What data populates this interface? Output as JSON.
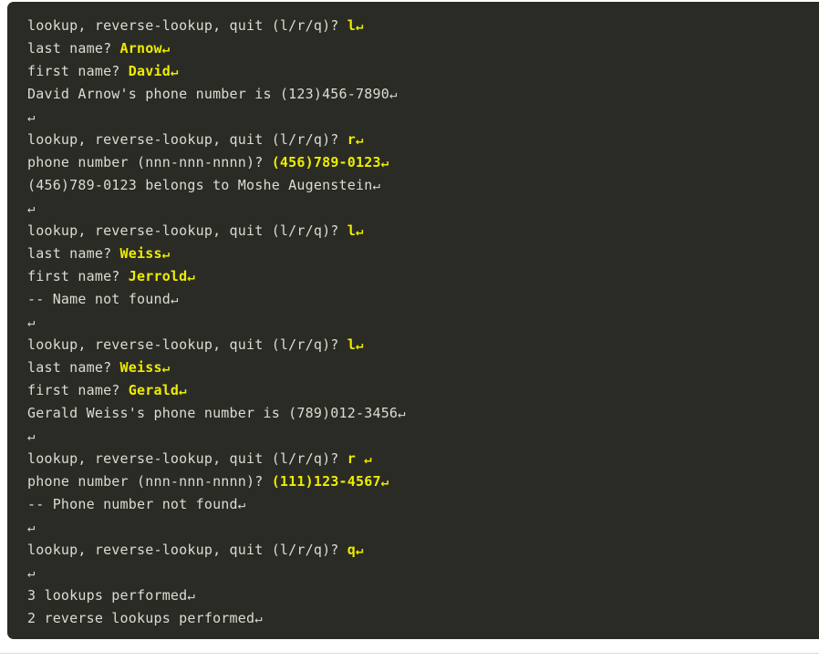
{
  "page": {
    "background_color": "#ffffff",
    "bottom_rule_color": "#d8d8d8"
  },
  "console": {
    "background_color": "#2b2b26",
    "output_text_color": "#dcdcd4",
    "input_text_color": "#eded00",
    "return_glyph": "↵",
    "lines": [
      {
        "index": 0,
        "segments": [
          {
            "kind": "output",
            "text": "lookup, reverse-lookup, quit (l/r/q)? "
          },
          {
            "kind": "input",
            "text": "l"
          },
          {
            "kind": "return-input",
            "text": "↵"
          }
        ]
      },
      {
        "index": 1,
        "segments": [
          {
            "kind": "output",
            "text": "last name? "
          },
          {
            "kind": "input",
            "text": "Arnow"
          },
          {
            "kind": "return-input",
            "text": "↵"
          }
        ]
      },
      {
        "index": 2,
        "segments": [
          {
            "kind": "output",
            "text": "first name? "
          },
          {
            "kind": "input",
            "text": "David"
          },
          {
            "kind": "return-input",
            "text": "↵"
          }
        ]
      },
      {
        "index": 3,
        "segments": [
          {
            "kind": "output",
            "text": "David Arnow's phone number is (123)456-7890"
          },
          {
            "kind": "return-output",
            "text": "↵"
          }
        ]
      },
      {
        "index": 4,
        "segments": [
          {
            "kind": "return-output",
            "text": "↵"
          }
        ]
      },
      {
        "index": 5,
        "segments": [
          {
            "kind": "output",
            "text": "lookup, reverse-lookup, quit (l/r/q)? "
          },
          {
            "kind": "input",
            "text": "r"
          },
          {
            "kind": "return-input",
            "text": "↵"
          }
        ]
      },
      {
        "index": 6,
        "segments": [
          {
            "kind": "output",
            "text": "phone number (nnn-nnn-nnnn)? "
          },
          {
            "kind": "input",
            "text": "(456)789-0123"
          },
          {
            "kind": "return-input",
            "text": "↵"
          }
        ]
      },
      {
        "index": 7,
        "segments": [
          {
            "kind": "output",
            "text": "(456)789-0123 belongs to Moshe Augenstein"
          },
          {
            "kind": "return-output",
            "text": "↵"
          }
        ]
      },
      {
        "index": 8,
        "segments": [
          {
            "kind": "return-output",
            "text": "↵"
          }
        ]
      },
      {
        "index": 9,
        "segments": [
          {
            "kind": "output",
            "text": "lookup, reverse-lookup, quit (l/r/q)? "
          },
          {
            "kind": "input",
            "text": "l"
          },
          {
            "kind": "return-input",
            "text": "↵"
          }
        ]
      },
      {
        "index": 10,
        "segments": [
          {
            "kind": "output",
            "text": "last name? "
          },
          {
            "kind": "input",
            "text": "Weiss"
          },
          {
            "kind": "return-input",
            "text": "↵"
          }
        ]
      },
      {
        "index": 11,
        "segments": [
          {
            "kind": "output",
            "text": "first name? "
          },
          {
            "kind": "input",
            "text": "Jerrold"
          },
          {
            "kind": "return-input",
            "text": "↵"
          }
        ]
      },
      {
        "index": 12,
        "segments": [
          {
            "kind": "output",
            "text": "-- Name not found"
          },
          {
            "kind": "return-output",
            "text": "↵"
          }
        ]
      },
      {
        "index": 13,
        "segments": [
          {
            "kind": "return-output",
            "text": "↵"
          }
        ]
      },
      {
        "index": 14,
        "segments": [
          {
            "kind": "output",
            "text": "lookup, reverse-lookup, quit (l/r/q)? "
          },
          {
            "kind": "input",
            "text": "l"
          },
          {
            "kind": "return-input",
            "text": "↵"
          }
        ]
      },
      {
        "index": 15,
        "segments": [
          {
            "kind": "output",
            "text": "last name? "
          },
          {
            "kind": "input",
            "text": "Weiss"
          },
          {
            "kind": "return-input",
            "text": "↵"
          }
        ]
      },
      {
        "index": 16,
        "segments": [
          {
            "kind": "output",
            "text": "first name? "
          },
          {
            "kind": "input",
            "text": "Gerald"
          },
          {
            "kind": "return-input",
            "text": "↵"
          }
        ]
      },
      {
        "index": 17,
        "segments": [
          {
            "kind": "output",
            "text": "Gerald Weiss's phone number is (789)012-3456"
          },
          {
            "kind": "return-output",
            "text": "↵"
          }
        ]
      },
      {
        "index": 18,
        "segments": [
          {
            "kind": "return-output",
            "text": "↵"
          }
        ]
      },
      {
        "index": 19,
        "segments": [
          {
            "kind": "output",
            "text": "lookup, reverse-lookup, quit (l/r/q)? "
          },
          {
            "kind": "input",
            "text": "r "
          },
          {
            "kind": "return-input",
            "text": "↵"
          }
        ]
      },
      {
        "index": 20,
        "segments": [
          {
            "kind": "output",
            "text": "phone number (nnn-nnn-nnnn)? "
          },
          {
            "kind": "input",
            "text": "(111)123-4567"
          },
          {
            "kind": "return-input",
            "text": "↵"
          }
        ]
      },
      {
        "index": 21,
        "segments": [
          {
            "kind": "output",
            "text": "-- Phone number not found"
          },
          {
            "kind": "return-output",
            "text": "↵"
          }
        ]
      },
      {
        "index": 22,
        "segments": [
          {
            "kind": "return-output",
            "text": "↵"
          }
        ]
      },
      {
        "index": 23,
        "segments": [
          {
            "kind": "output",
            "text": "lookup, reverse-lookup, quit (l/r/q)? "
          },
          {
            "kind": "input",
            "text": "q"
          },
          {
            "kind": "return-input",
            "text": "↵"
          }
        ]
      },
      {
        "index": 24,
        "segments": [
          {
            "kind": "return-output",
            "text": "↵"
          }
        ]
      },
      {
        "index": 25,
        "segments": [
          {
            "kind": "output",
            "text": "3 lookups performed"
          },
          {
            "kind": "return-output",
            "text": "↵"
          }
        ]
      },
      {
        "index": 26,
        "segments": [
          {
            "kind": "output",
            "text": "2 reverse lookups performed"
          },
          {
            "kind": "return-output",
            "text": "↵"
          }
        ]
      }
    ]
  }
}
